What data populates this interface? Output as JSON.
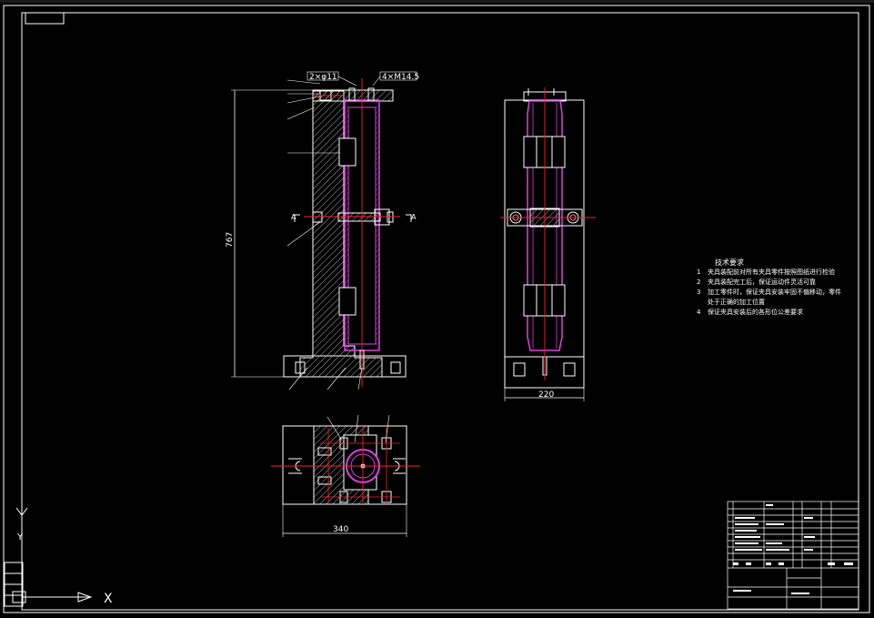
{
  "drawing": {
    "tolerance_callouts": [
      "2×φ11",
      "4×M14.5"
    ],
    "dimensions": {
      "front_height": "767",
      "side_width": "220",
      "top_width": "340"
    },
    "section_letters": [
      "A",
      "A"
    ]
  },
  "technical_requirements": {
    "title": "技术要求",
    "items": [
      {
        "num": "1",
        "text": "夹具装配前对所有夹具零件按照图纸进行检验"
      },
      {
        "num": "2",
        "text": "夹具装配完工后，保证运动件灵活可靠"
      },
      {
        "num": "3",
        "text": "加工零件时，保证夹具安装牢固不偏移动，零件"
      },
      {
        "num": "",
        "text": "处于正确的加工位置"
      },
      {
        "num": "4",
        "text": "保证夹具安装后的各形位公差要求"
      }
    ]
  },
  "ucs": {
    "x_label": "X",
    "y_label": "Y"
  },
  "colors": {
    "line": "#ffffff",
    "center": "#ff2020",
    "part": "#e040e0",
    "hatch": "#bbbbbb",
    "green": "#00cc44"
  },
  "icons": [
    "ucs-icon"
  ]
}
